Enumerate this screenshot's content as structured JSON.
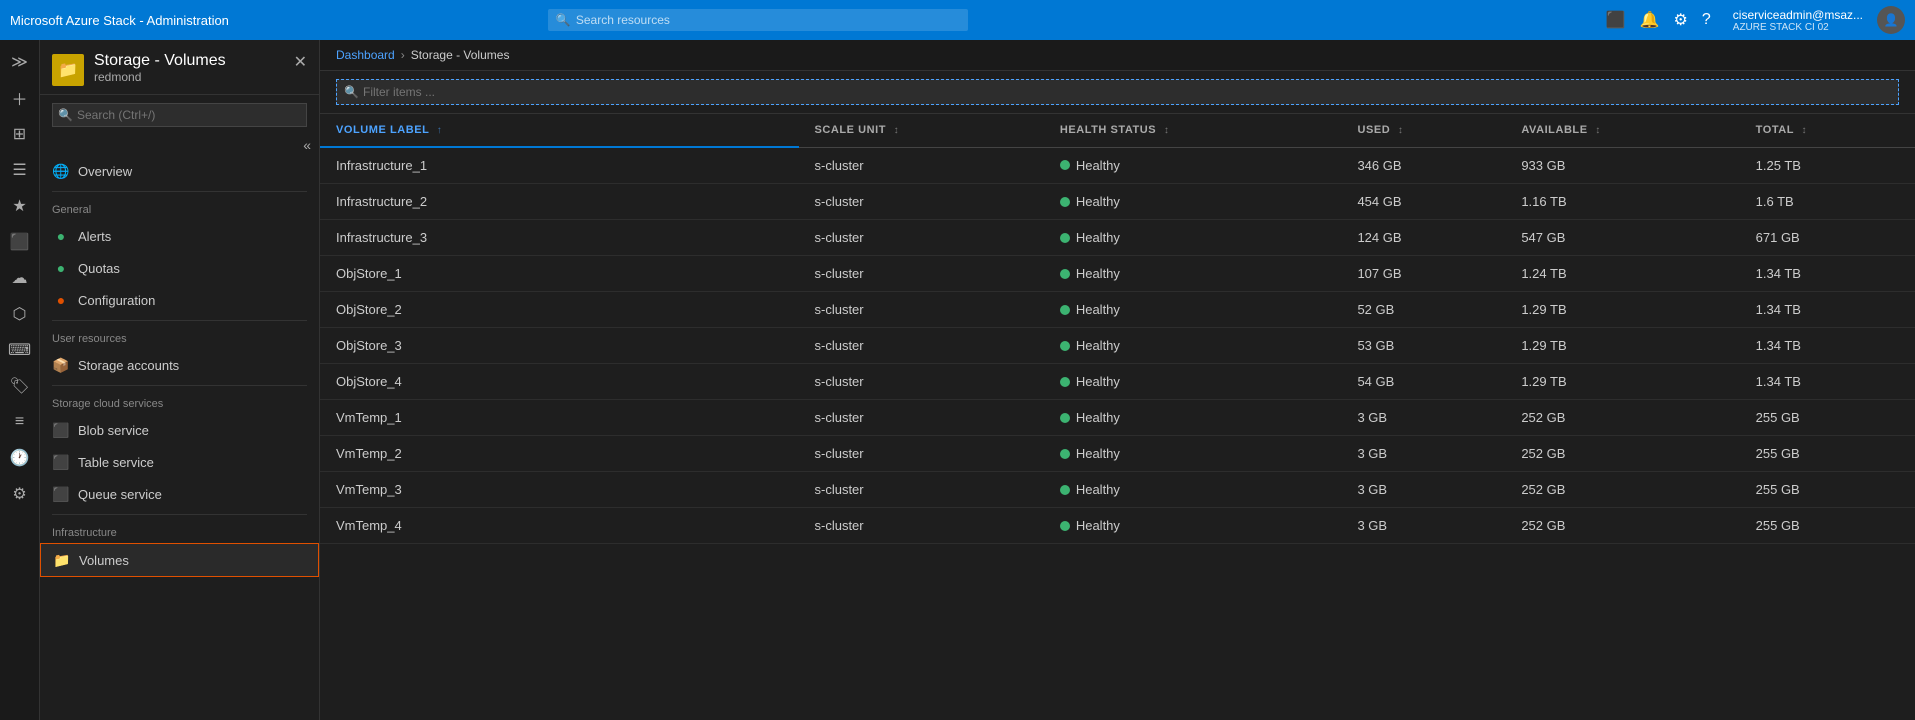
{
  "topbar": {
    "title": "Microsoft Azure Stack - Administration",
    "search_placeholder": "Search resources",
    "user_name": "ciserviceadmin@msaz...",
    "user_sub": "AZURE STACK CI 02"
  },
  "breadcrumb": {
    "items": [
      "Dashboard",
      "Storage - Volumes"
    ]
  },
  "sidebar": {
    "header_title": "Storage - Volumes",
    "header_sub": "redmond",
    "search_placeholder": "Search (Ctrl+/)",
    "sections": [
      {
        "label": "",
        "items": [
          {
            "id": "overview",
            "label": "Overview",
            "icon": "🌐"
          }
        ]
      },
      {
        "label": "General",
        "items": [
          {
            "id": "alerts",
            "label": "Alerts",
            "icon": "🔔"
          },
          {
            "id": "quotas",
            "label": "Quotas",
            "icon": "🟢"
          },
          {
            "id": "configuration",
            "label": "Configuration",
            "icon": "🔴"
          }
        ]
      },
      {
        "label": "User resources",
        "items": [
          {
            "id": "storage-accounts",
            "label": "Storage accounts",
            "icon": "📦"
          }
        ]
      },
      {
        "label": "Storage cloud services",
        "items": [
          {
            "id": "blob-service",
            "label": "Blob service",
            "icon": "🔷"
          },
          {
            "id": "table-service",
            "label": "Table service",
            "icon": "🟫"
          },
          {
            "id": "queue-service",
            "label": "Queue service",
            "icon": "🟪"
          }
        ]
      },
      {
        "label": "Infrastructure",
        "items": [
          {
            "id": "volumes",
            "label": "Volumes",
            "icon": "📁",
            "active": true
          }
        ]
      }
    ]
  },
  "filter": {
    "placeholder": "Filter items ..."
  },
  "table": {
    "columns": [
      {
        "id": "volume_label",
        "label": "VOLUME LABEL",
        "active": true
      },
      {
        "id": "scale_unit",
        "label": "SCALE UNIT"
      },
      {
        "id": "health_status",
        "label": "HEALTH STATUS"
      },
      {
        "id": "used",
        "label": "USED"
      },
      {
        "id": "available",
        "label": "AVAILABLE"
      },
      {
        "id": "total",
        "label": "TOTAL"
      }
    ],
    "rows": [
      {
        "volume_label": "Infrastructure_1",
        "scale_unit": "s-cluster",
        "health_status": "Healthy",
        "used": "346 GB",
        "available": "933 GB",
        "total": "1.25 TB"
      },
      {
        "volume_label": "Infrastructure_2",
        "scale_unit": "s-cluster",
        "health_status": "Healthy",
        "used": "454 GB",
        "available": "1.16 TB",
        "total": "1.6 TB"
      },
      {
        "volume_label": "Infrastructure_3",
        "scale_unit": "s-cluster",
        "health_status": "Healthy",
        "used": "124 GB",
        "available": "547 GB",
        "total": "671 GB"
      },
      {
        "volume_label": "ObjStore_1",
        "scale_unit": "s-cluster",
        "health_status": "Healthy",
        "used": "107 GB",
        "available": "1.24 TB",
        "total": "1.34 TB"
      },
      {
        "volume_label": "ObjStore_2",
        "scale_unit": "s-cluster",
        "health_status": "Healthy",
        "used": "52 GB",
        "available": "1.29 TB",
        "total": "1.34 TB"
      },
      {
        "volume_label": "ObjStore_3",
        "scale_unit": "s-cluster",
        "health_status": "Healthy",
        "used": "53 GB",
        "available": "1.29 TB",
        "total": "1.34 TB"
      },
      {
        "volume_label": "ObjStore_4",
        "scale_unit": "s-cluster",
        "health_status": "Healthy",
        "used": "54 GB",
        "available": "1.29 TB",
        "total": "1.34 TB"
      },
      {
        "volume_label": "VmTemp_1",
        "scale_unit": "s-cluster",
        "health_status": "Healthy",
        "used": "3 GB",
        "available": "252 GB",
        "total": "255 GB"
      },
      {
        "volume_label": "VmTemp_2",
        "scale_unit": "s-cluster",
        "health_status": "Healthy",
        "used": "3 GB",
        "available": "252 GB",
        "total": "255 GB"
      },
      {
        "volume_label": "VmTemp_3",
        "scale_unit": "s-cluster",
        "health_status": "Healthy",
        "used": "3 GB",
        "available": "252 GB",
        "total": "255 GB"
      },
      {
        "volume_label": "VmTemp_4",
        "scale_unit": "s-cluster",
        "health_status": "Healthy",
        "used": "3 GB",
        "available": "252 GB",
        "total": "255 GB"
      }
    ]
  },
  "icons": {
    "search": "🔍",
    "expand": "≫",
    "collapse": "«",
    "close": "✕",
    "sort_asc": "↑",
    "sort_both": "↕"
  }
}
